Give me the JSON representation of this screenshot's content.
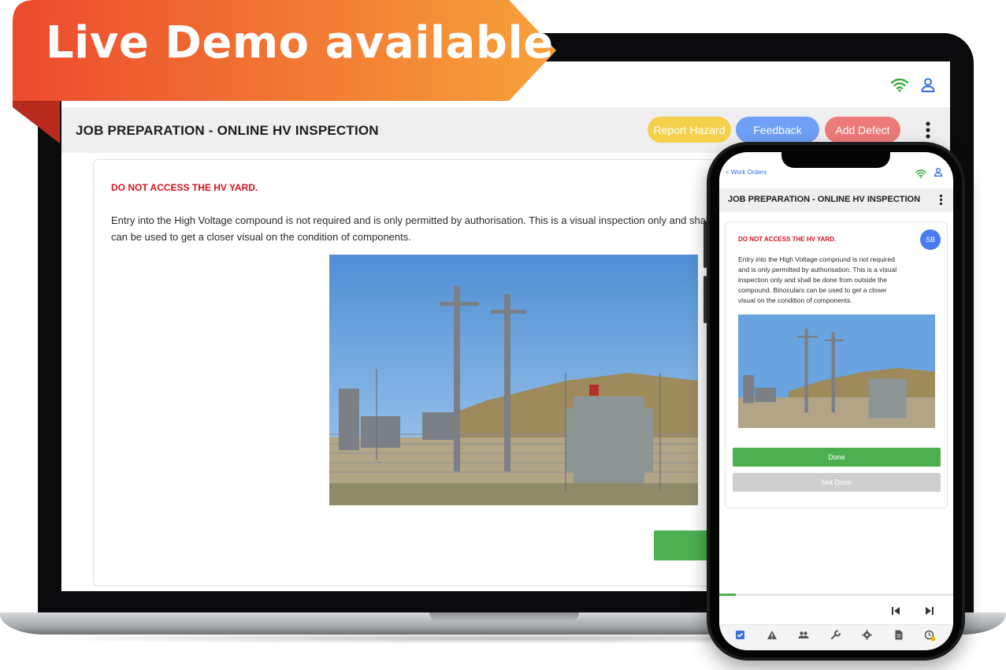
{
  "banner": {
    "text": "Live Demo available"
  },
  "desktop": {
    "header": {
      "title": "JOB PREPARATION - ONLINE HV INSPECTION",
      "buttons": {
        "report_hazard": "Report Hazard",
        "feedback": "Feedback",
        "add_defect": "Add Defect"
      }
    },
    "card": {
      "warning": "DO NOT ACCESS THE HV YARD.",
      "description": "Entry into the High Voltage compound is not required and is only permitted by authorisation. This is a visual inspection only and shall be dor Binoculars can be used to get a closer visual on the condition of components."
    }
  },
  "mobile": {
    "back_link": "< Work Orders",
    "header": {
      "title": "JOB PREPARATION - ONLINE HV INSPECTION"
    },
    "card": {
      "warning": "DO NOT ACCESS THE HV YARD.",
      "avatar_initials": "SB",
      "description": "Entry into the High Voltage compound is not required and is only permitted by authorisation. This is a visual inspection only and shall be done from outside the compound. Binoculars can be used to get a closer visual on the condition of components.",
      "done_label": "Done",
      "not_done_label": "Not Done"
    },
    "progress_fraction": 0.07,
    "bottom_nav": [
      "checklist-icon",
      "warning-icon",
      "people-icon",
      "wrench-icon",
      "gear-icon",
      "document-icon",
      "clock-alert-icon"
    ]
  },
  "colors": {
    "brand_green": "#4caf50",
    "hazard_yellow": "#f5d04b",
    "feedback_blue": "#6f9ff6",
    "defect_red": "#ec7b78",
    "warning_red": "#d4141c",
    "banner_start": "#ec4a2c",
    "banner_end": "#f7a23a"
  }
}
